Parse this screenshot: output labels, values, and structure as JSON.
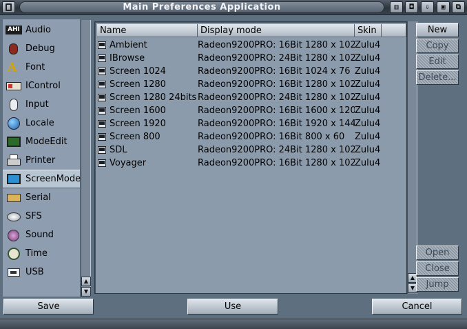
{
  "window": {
    "title": "Main Preferences Application"
  },
  "title_gadgets": [
    "iconify-icon",
    "depth-icon",
    "snapshot-icon",
    "zoom-icon",
    "front-back-icon"
  ],
  "sidebar": {
    "items": [
      {
        "label": "Audio",
        "icon": "ahi-icon"
      },
      {
        "label": "Debug",
        "icon": "bug-icon"
      },
      {
        "label": "Font",
        "icon": "font-icon"
      },
      {
        "label": "IControl",
        "icon": "icontrol-icon"
      },
      {
        "label": "Input",
        "icon": "mouse-icon"
      },
      {
        "label": "Locale",
        "icon": "globe-icon"
      },
      {
        "label": "ModeEdit",
        "icon": "monitor-icon"
      },
      {
        "label": "Printer",
        "icon": "printer-icon"
      },
      {
        "label": "ScreenMode",
        "icon": "screenmode-icon",
        "selected": true
      },
      {
        "label": "Serial",
        "icon": "serial-icon"
      },
      {
        "label": "SFS",
        "icon": "disk-icon"
      },
      {
        "label": "Sound",
        "icon": "speaker-icon"
      },
      {
        "label": "Time",
        "icon": "clock-icon"
      },
      {
        "label": "USB",
        "icon": "usb-icon"
      }
    ]
  },
  "table": {
    "columns": [
      "Name",
      "Display mode",
      "Skin"
    ],
    "rows": [
      {
        "name": "Ambient",
        "mode": "Radeon9200PRO: 16Bit 1280 x 102",
        "skin": "Zulu4"
      },
      {
        "name": "IBrowse",
        "mode": "Radeon9200PRO: 24Bit 1280 x 102",
        "skin": "Zulu4"
      },
      {
        "name": "Screen 1024",
        "mode": "Radeon9200PRO: 16Bit 1024 x  76",
        "skin": "Zulu4"
      },
      {
        "name": "Screen 1280",
        "mode": "Radeon9200PRO: 16Bit 1280 x 102",
        "skin": "Zulu4"
      },
      {
        "name": "Screen 1280 24bits",
        "mode": "Radeon9200PRO: 24Bit 1280 x 102",
        "skin": "Zulu4"
      },
      {
        "name": "Screen 1600",
        "mode": "Radeon9200PRO: 16Bit 1600 x 120",
        "skin": "Zulu4"
      },
      {
        "name": "Screen 1920",
        "mode": "Radeon9200PRO: 16Bit 1920 x 144",
        "skin": "Zulu4"
      },
      {
        "name": "Screen 800",
        "mode": "Radeon9200PRO: 16Bit  800 x  60",
        "skin": "Zulu4"
      },
      {
        "name": "SDL",
        "mode": "Radeon9200PRO: 24Bit 1280 x 102",
        "skin": "Zulu4"
      },
      {
        "name": "Voyager",
        "mode": "Radeon9200PRO: 16Bit 1280 x 102",
        "skin": "Zulu4"
      }
    ]
  },
  "actions": {
    "new": "New",
    "copy": "Copy",
    "edit": "Edit",
    "delete": "Delete...",
    "open": "Open",
    "close": "Close",
    "jump": "Jump"
  },
  "bottom": {
    "save": "Save",
    "use": "Use",
    "cancel": "Cancel"
  }
}
